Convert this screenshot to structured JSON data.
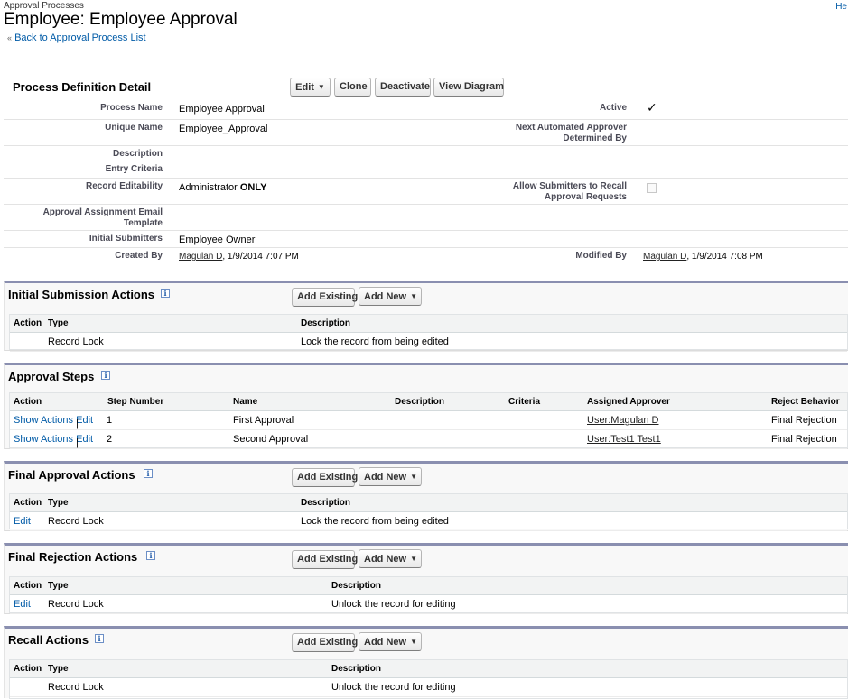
{
  "header": {
    "breadcrumb": "Approval Processes",
    "help": "He",
    "title": "Employee: Employee Approval",
    "back_link": "Back to Approval Process List",
    "back_chevron": "«"
  },
  "detail": {
    "title": "Process Definition Detail",
    "buttons": {
      "edit": "Edit",
      "clone": "Clone",
      "deactivate": "Deactivate",
      "view_diagram": "View Diagram"
    },
    "fields": {
      "process_name_label": "Process Name",
      "process_name": "Employee Approval",
      "active_label": "Active",
      "active_mark": "✓",
      "unique_name_label": "Unique Name",
      "unique_name": "Employee_Approval",
      "next_approver_label": "Next Automated Approver Determined By",
      "description_label": "Description",
      "entry_criteria_label": "Entry Criteria",
      "record_editability_label": "Record Editability",
      "record_editability_prefix": "Administrator",
      "record_editability_emph": "ONLY",
      "allow_recall_label": "Allow Submitters to Recall Approval Requests",
      "email_template_label": "Approval Assignment Email Template",
      "initial_submitters_label": "Initial Submitters",
      "initial_submitters": "Employee Owner",
      "created_by_label": "Created By",
      "created_by_user": "Magulan D",
      "created_by_date": ", 1/9/2014 7:07 PM",
      "modified_by_label": "Modified By",
      "modified_by_user": "Magulan D",
      "modified_by_date": ", 1/9/2014 7:08 PM"
    }
  },
  "common": {
    "add_existing": "Add Existing",
    "add_new": "Add New",
    "info": "i",
    "show_actions": "Show Actions",
    "pipe": "|",
    "edit": "Edit"
  },
  "initial_submission": {
    "title": "Initial Submission Actions",
    "headers": [
      "Action",
      "Type",
      "Description"
    ],
    "rows": [
      {
        "type": "Record Lock",
        "description": "Lock the record from being edited"
      }
    ]
  },
  "approval_steps": {
    "title": "Approval Steps",
    "headers": [
      "Action",
      "Step Number",
      "Name",
      "Description",
      "Criteria",
      "Assigned Approver",
      "Reject Behavior"
    ],
    "rows": [
      {
        "step": "1",
        "name": "First Approval",
        "approver": "User:Magulan D",
        "reject": "Final Rejection"
      },
      {
        "step": "2",
        "name": "Second Approval",
        "approver": "User:Test1 Test1",
        "reject": "Final Rejection"
      }
    ]
  },
  "final_approval": {
    "title": "Final Approval Actions",
    "headers": [
      "Action",
      "Type",
      "Description"
    ],
    "rows": [
      {
        "type": "Record Lock",
        "description": "Lock the record from being edited"
      }
    ]
  },
  "final_rejection": {
    "title": "Final Rejection Actions",
    "headers": [
      "Action",
      "Type",
      "Description"
    ],
    "rows": [
      {
        "type": "Record Lock",
        "description": "Unlock the record for editing"
      }
    ]
  },
  "recall": {
    "title": "Recall Actions",
    "headers": [
      "Action",
      "Type",
      "Description"
    ],
    "rows": [
      {
        "type": "Record Lock",
        "description": "Unlock the record for editing"
      }
    ]
  },
  "colors": {
    "link": "#015ba7",
    "section_border": "#8a8fb0",
    "header_bg": "#f2f3f3"
  },
  "icons": {
    "info": "info-icon",
    "dropdown": "caret-down-icon",
    "back": "double-chevron-left-icon",
    "checkmark": "checkmark-icon",
    "checkbox": "checkbox-icon"
  }
}
